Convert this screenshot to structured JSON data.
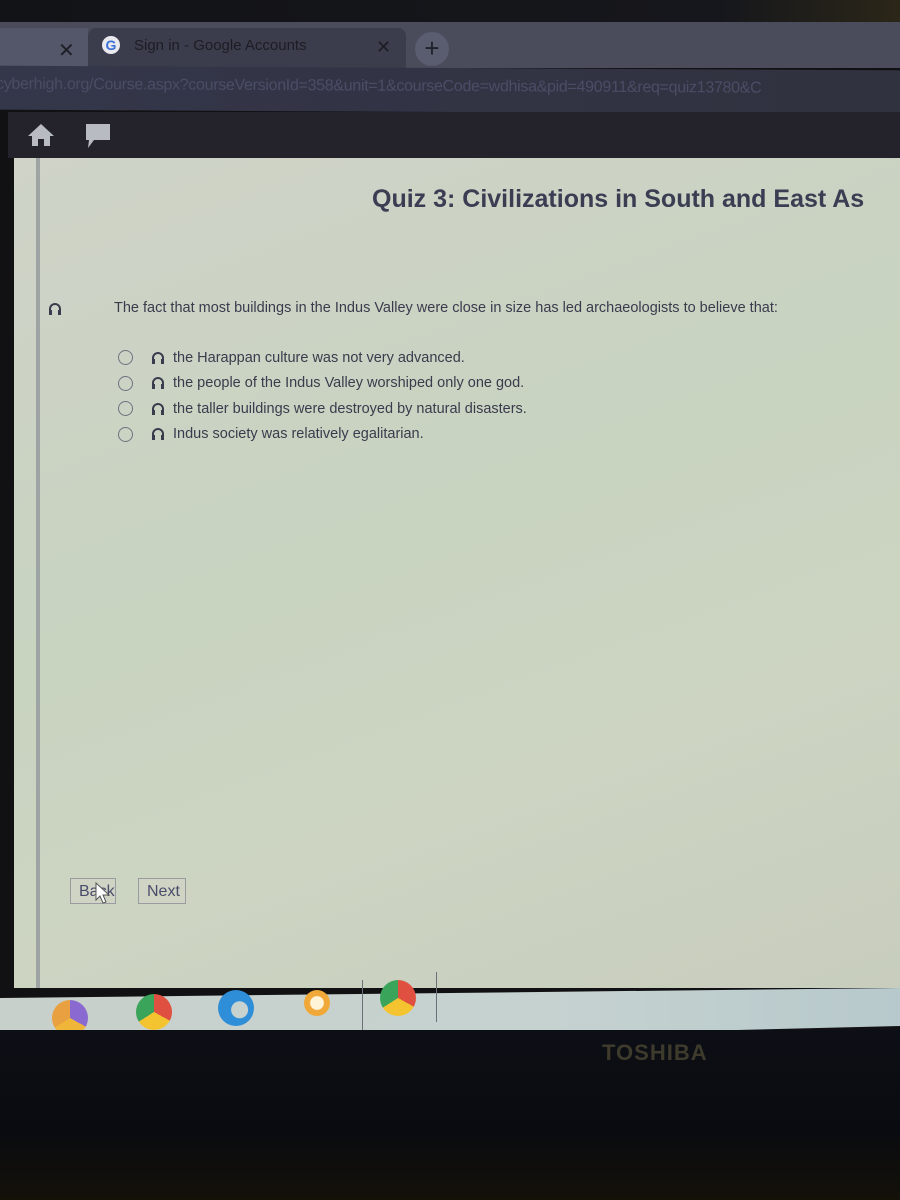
{
  "browser": {
    "tabs": [
      {
        "label": "",
        "close_icon": "close-icon"
      },
      {
        "label": "Sign in - Google Accounts",
        "favicon": "google-icon",
        "close_icon": "close-icon"
      }
    ],
    "new_tab_label": "+",
    "url": "cyberhigh.org/Course.aspx?courseVersionId=358&unit=1&courseCode=wdhisa&pid=490911&req=quiz13780&C"
  },
  "site_toolbar": {
    "icons": [
      "home-icon",
      "chat-icon"
    ]
  },
  "quiz": {
    "title": "Quiz 3: Civilizations in South and East As",
    "question": "The fact that most buildings in the Indus Valley were close in size has led archaeologists to believe that:",
    "options": [
      {
        "label": "the Harappan culture was not very advanced.",
        "selected": false
      },
      {
        "label": "the people of the Indus Valley worshiped only one god.",
        "selected": false
      },
      {
        "label": "the taller buildings were destroyed by natural disasters.",
        "selected": false
      },
      {
        "label": "Indus society was relatively egalitarian.",
        "selected": false
      }
    ],
    "back_label": "Back",
    "next_label": "Next"
  },
  "taskbar": {
    "apps": [
      "security-app-icon",
      "chrome-icon",
      "edge-icon",
      "media-player-icon",
      "chrome-profile-icon"
    ]
  },
  "device": {
    "brand": "TOSHIBA"
  },
  "colors": {
    "title_text": "#3b3d52",
    "content_bg": "#cdd3c4",
    "toolbar_bg": "#24232b"
  }
}
